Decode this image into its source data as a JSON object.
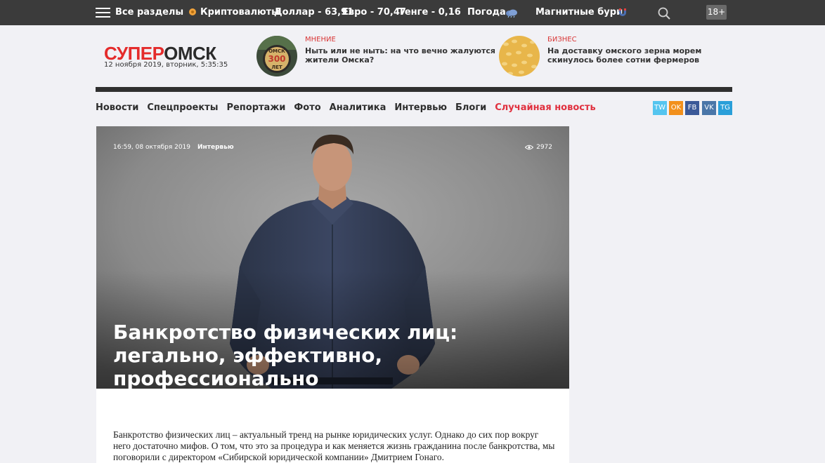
{
  "topbar": {
    "sections_label": "Все разделы",
    "crypto_label": "Криптовалюты",
    "dollar": "Доллар - 63,91",
    "euro": "Евро - 70,47",
    "tenge": "Тенге - 0,16",
    "weather_label": "Погода",
    "storms_label": "Магнитные бури",
    "age_badge": "18+"
  },
  "header": {
    "logo_part1": "СУПЕР",
    "logo_part2": "ОМСК",
    "date": "12 ноября 2019, вторник, 5:35:35",
    "teasers": [
      {
        "category": "Мнение",
        "title": "Ныть или не ныть: на что вечно жалуются жители Омска?",
        "thumb_text_1": "ОМСК",
        "thumb_text_2": "300",
        "thumb_text_3": "ЛЕТ"
      },
      {
        "category": "Бизнес",
        "title": "На доставку омского зерна морем скинулось более сотни фермеров"
      }
    ]
  },
  "nav": {
    "items": [
      "Новости",
      "Спецпроекты",
      "Репортажи",
      "Фото",
      "Аналитика",
      "Интервью",
      "Блоги"
    ],
    "random": "Случайная новость"
  },
  "social": [
    {
      "label": "TW",
      "color": "#55c5ef"
    },
    {
      "label": "OK",
      "color": "#f2901c"
    },
    {
      "label": "FB",
      "color": "#3b5998"
    },
    {
      "label": "VK",
      "color": "#4a76a8"
    },
    {
      "label": "TG",
      "color": "#2a9fd9"
    }
  ],
  "article": {
    "datetime": "16:59, 08 октября 2019",
    "category": "Интервью",
    "views": "2972",
    "title": "Банкротство физических лиц: легально, эффективно, профессионально",
    "lead": "Банкротство физических лиц – актуальный тренд на рынке юридических услуг. Однако до сих пор вокруг него достаточно мифов. О том, что это за процедура и как меняется жизнь гражданина после банкротства, мы поговорили с директором «Сибирской юридической компании» Дмитрием Гонаго."
  },
  "colors": {
    "accent": "#e42b2b",
    "topbar": "#3b3b3b",
    "page_bg": "#f1f1f5"
  }
}
